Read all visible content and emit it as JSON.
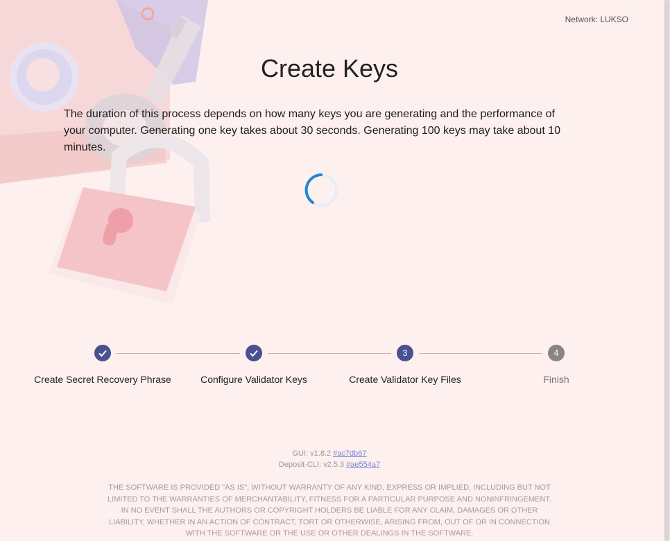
{
  "header": {
    "network_label": "Network: LUKSO"
  },
  "main": {
    "title": "Create Keys",
    "description": "The duration of this process depends on how many keys you are generating and the performance of your computer. Generating one key takes about 30 seconds. Generating 100 keys may take about 10 minutes."
  },
  "stepper": {
    "steps": [
      {
        "label": "Create Secret Recovery Phrase",
        "state": "completed"
      },
      {
        "label": "Configure Validator Keys",
        "state": "completed"
      },
      {
        "label": "Create Validator Key Files",
        "state": "active",
        "number": "3"
      },
      {
        "label": "Finish",
        "state": "inactive",
        "number": "4"
      }
    ]
  },
  "footer": {
    "gui_version": "GUI: v1.8.2",
    "gui_commit": "#ac7db67",
    "cli_version": "Deposit-CLI: v2.5.3",
    "cli_commit": "#ae554a7",
    "license": "THE SOFTWARE IS PROVIDED \"AS IS\", WITHOUT WARRANTY OF ANY KIND, EXPRESS OR IMPLIED, INCLUDING BUT NOT LIMITED TO THE WARRANTIES OF MERCHANTABILITY, FITNESS FOR A PARTICULAR PURPOSE AND NONINFRINGEMENT. IN NO EVENT SHALL THE AUTHORS OR COPYRIGHT HOLDERS BE LIABLE FOR ANY CLAIM, DAMAGES OR OTHER LIABILITY, WHETHER IN AN ACTION OF CONTRACT, TORT OR OTHERWISE, ARISING FROM, OUT OF OR IN CONNECTION WITH THE SOFTWARE OR THE USE OR OTHER DEALINGS IN THE SOFTWARE."
  },
  "colors": {
    "background": "#fdf0ef",
    "step_active": "#4a5190",
    "step_inactive": "#8a8585",
    "spinner": "#1e88d6",
    "link": "#7b88d0"
  },
  "icons": {
    "completed_step": "check-icon",
    "loading": "spinner-icon",
    "illustration": "lock-and-key-illustration"
  }
}
